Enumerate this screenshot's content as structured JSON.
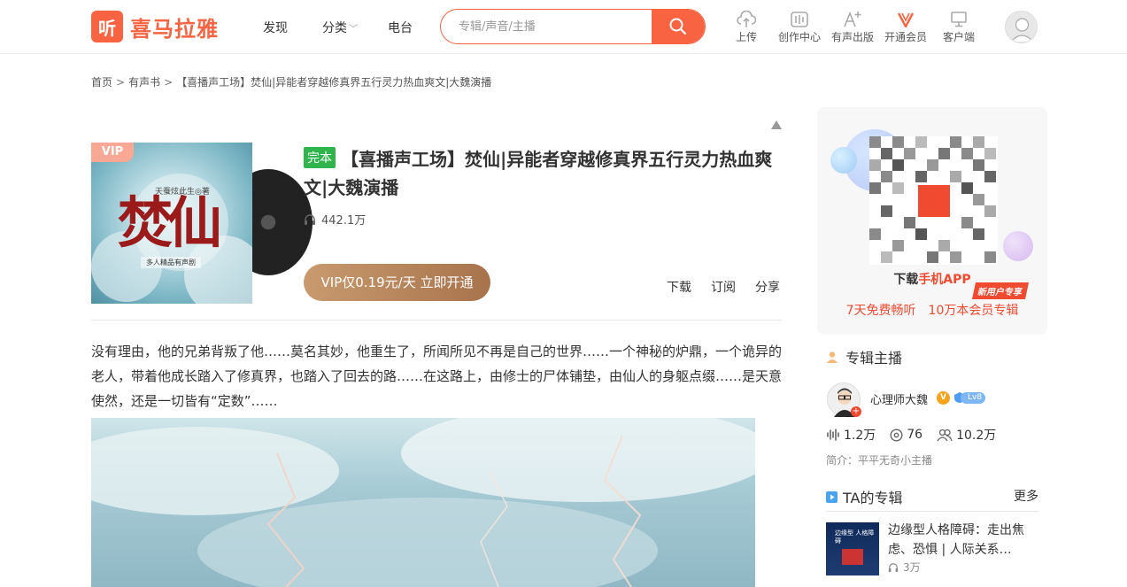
{
  "brand": {
    "logo_mark": "听",
    "logo_text": "喜马拉雅",
    "accent": "#f86442"
  },
  "nav": {
    "discover": "发现",
    "category": "分类",
    "radio": "电台"
  },
  "search": {
    "placeholder": "专辑/声音/主播"
  },
  "tools": [
    {
      "label": "上传",
      "icon": "upload-cloud-icon"
    },
    {
      "label": "创作中心",
      "icon": "mixer-icon"
    },
    {
      "label": "有声出版",
      "icon": "text-add-icon"
    },
    {
      "label": "开通会员",
      "icon": "vip-v-icon"
    },
    {
      "label": "客户端",
      "icon": "monitor-icon"
    }
  ],
  "breadcrumb": {
    "home": "首页",
    "audiobook": "有声书",
    "current": "【喜播声工场】焚仙|异能者穿越修真界五行灵力热血爽文|大魏演播",
    "sep": ">"
  },
  "album": {
    "badge": "完本",
    "title": "【喜播声工场】焚仙|异能者穿越修真界五行灵力热血爽文|大魏演播",
    "plays": "442.1万",
    "cover_vip": "VIP",
    "cover_title": "焚仙",
    "cover_author": "天蚕炫此生◎著",
    "cover_sub": "多人精品有声剧",
    "vip_button": "VIP仅0.19元/天 立即开通",
    "download": "下载",
    "subscribe": "订阅",
    "share": "分享",
    "intro": "没有理由，他的兄弟背叛了他……莫名其妙，他重生了，所闻所见不再是自己的世界……一个神秘的炉鼎，一个诡异的老人，带着他成长踏入了修真界，也踏入了回去的路……在这路上，由修士的尸体铺垫，由仙人的身躯点缀……是天意使然，还是一切皆有“定数”……"
  },
  "app_card": {
    "download_prefix": "下载",
    "download_highlight": "手机APP",
    "new_user_badge": "新用户专享",
    "promo_1": "7天免费畅听",
    "promo_2": "10万本会员专辑"
  },
  "anchor": {
    "section_title": "专辑主播",
    "name": "心理师大魏",
    "v_badge": "V",
    "level": "Lv8",
    "plays": "1.2万",
    "albums": "76",
    "followers": "10.2万",
    "bio": "简介：平平无奇小主播"
  },
  "ta_albums": {
    "section_title": "TA的专辑",
    "more": "更多",
    "items": [
      {
        "title": "边缘型人格障碍：走出焦虑、恐惧 | 人际关系…",
        "plays": "3万",
        "thumb_text": "边缘型 人格障碍"
      }
    ]
  }
}
